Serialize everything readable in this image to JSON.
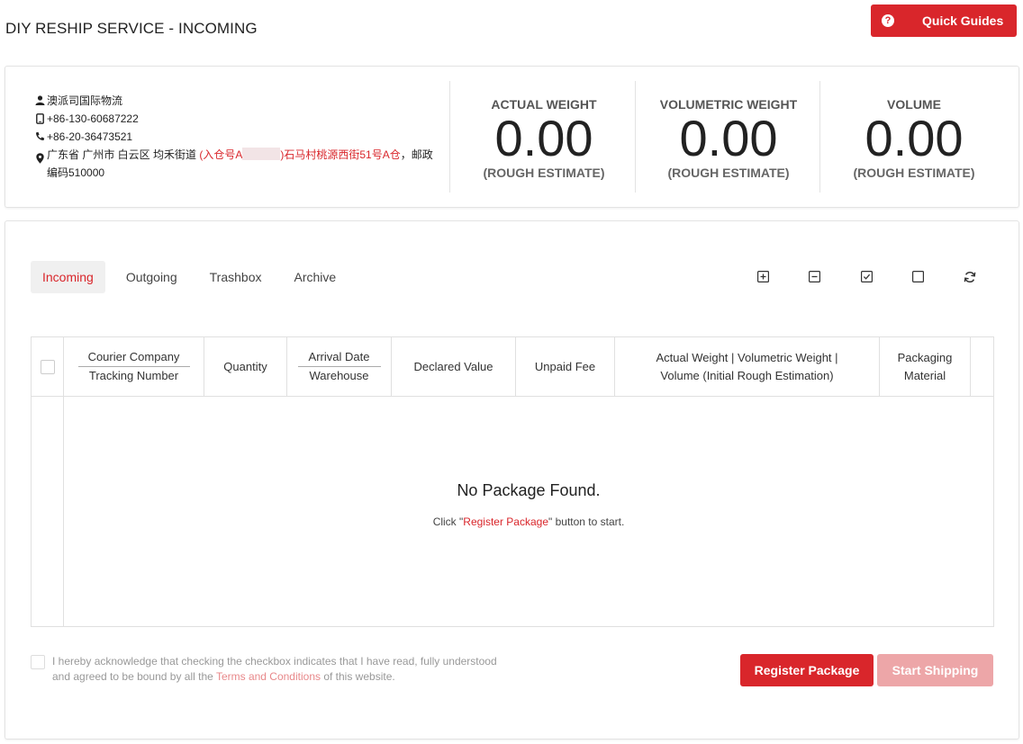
{
  "header": {
    "title": "DIY RESHIP SERVICE - INCOMING",
    "quick_guides_label": "Quick Guides",
    "quick_guides_icon": "?"
  },
  "address": {
    "name": "澳派司国际物流",
    "mobile": "+86-130-60687222",
    "phone": "+86-20-36473521",
    "address_prefix": "广东省 广州市 白云区 均禾街道 ",
    "address_highlight_a": "(入仓号A",
    "address_highlight_b": ")石马村桃源西街51号A仓",
    "address_suffix": "，邮政编码510000"
  },
  "stats": [
    {
      "label": "ACTUAL WEIGHT",
      "value": "0.00",
      "note": "(ROUGH ESTIMATE)"
    },
    {
      "label": "VOLUMETRIC WEIGHT",
      "value": "0.00",
      "note": "(ROUGH ESTIMATE)"
    },
    {
      "label": "VOLUME",
      "value": "0.00",
      "note": "(ROUGH ESTIMATE)"
    }
  ],
  "tabs": [
    {
      "label": "Incoming",
      "active": true
    },
    {
      "label": "Outgoing",
      "active": false
    },
    {
      "label": "Trashbox",
      "active": false
    },
    {
      "label": "Archive",
      "active": false
    }
  ],
  "toolbar_icons": [
    "expand-all-icon",
    "collapse-all-icon",
    "check-all-icon",
    "uncheck-all-icon",
    "refresh-icon"
  ],
  "table": {
    "columns": {
      "courier": "Courier Company",
      "tracking": "Tracking Number",
      "quantity": "Quantity",
      "arrival": "Arrival Date",
      "warehouse": "Warehouse",
      "declared": "Declared Value",
      "unpaid": "Unpaid Fee",
      "weights_line1": "Actual Weight | Volumetric Weight |",
      "weights_line2": "Volume (Initial Rough Estimation)",
      "packaging_line1": "Packaging",
      "packaging_line2": "Material"
    },
    "empty_title": "No Package Found.",
    "empty_prefix": "Click \"",
    "empty_link": "Register Package",
    "empty_suffix": "\" button to start."
  },
  "acknowledge": {
    "text_before": "I hereby acknowledge that checking the checkbox indicates that I have read, fully understood and agreed to be bound by all the ",
    "link": "Terms and Conditions",
    "text_after": " of this website."
  },
  "buttons": {
    "register": "Register Package",
    "start_shipping": "Start Shipping"
  },
  "colors": {
    "accent": "#d9262b",
    "accent_disabled": "#eda6a8"
  }
}
